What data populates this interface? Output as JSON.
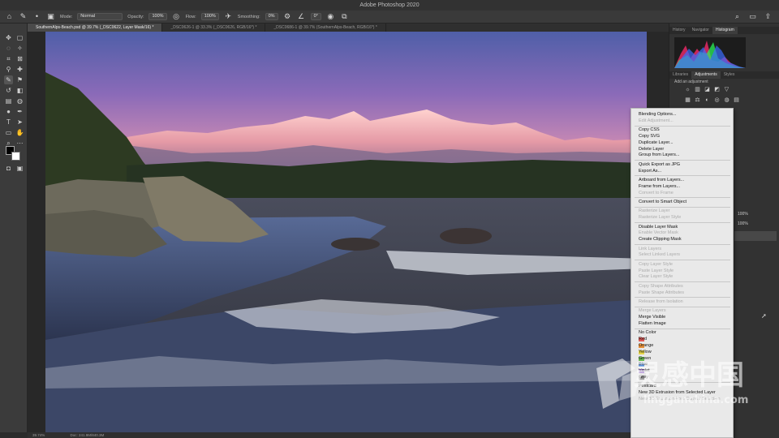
{
  "app": {
    "title": "Adobe Photoshop 2020"
  },
  "options_bar": {
    "mode_label": "Mode:",
    "mode_value": "Normal",
    "opacity_label": "Opacity:",
    "opacity_value": "100%",
    "flow_label": "Flow:",
    "flow_value": "100%",
    "smoothing_label": "Smoothing:",
    "smoothing_value": "0%",
    "angle_value": "0°"
  },
  "document_tabs": [
    {
      "label": "SouthernAlps-Beach.psd @ 39.7% (_DSC0622, Layer Mask/16) *"
    },
    {
      "label": "_DSC0626-1 @ 33.3% (_DSC0626, RGB/16*) *"
    },
    {
      "label": "_DSC0686-1 @ 39.7% (SouthernAlps-Beach, RGB/16*) *"
    }
  ],
  "status_bar": {
    "zoom": "39.74%",
    "doc_size": "Doc: 241.9M/840.3M"
  },
  "panels": {
    "top_tabs": [
      "History",
      "Navigator",
      "Histogram"
    ],
    "mid_tabs": [
      "Libraries",
      "Adjustments",
      "Styles"
    ],
    "add_adjustment_label": "Add an adjustment",
    "layer_opacity_value": "100%",
    "layer_fill_value": "100%"
  },
  "context_menu": {
    "groups": [
      [
        {
          "label": "Blending Options...",
          "enabled": true
        },
        {
          "label": "Edit Adjustment...",
          "enabled": false
        }
      ],
      [
        {
          "label": "Copy CSS",
          "enabled": true
        },
        {
          "label": "Copy SVG",
          "enabled": true
        },
        {
          "label": "Duplicate Layer...",
          "enabled": true
        },
        {
          "label": "Delete Layer",
          "enabled": true
        },
        {
          "label": "Group from Layers...",
          "enabled": true
        }
      ],
      [
        {
          "label": "Quick Export as JPG",
          "enabled": true
        },
        {
          "label": "Export As...",
          "enabled": true
        }
      ],
      [
        {
          "label": "Artboard from Layers...",
          "enabled": true
        },
        {
          "label": "Frame from Layers...",
          "enabled": true
        },
        {
          "label": "Convert to Frame",
          "enabled": false
        }
      ],
      [
        {
          "label": "Convert to Smart Object",
          "enabled": true
        }
      ],
      [
        {
          "label": "Rasterize Layer",
          "enabled": false
        },
        {
          "label": "Rasterize Layer Style",
          "enabled": false
        }
      ],
      [
        {
          "label": "Disable Layer Mask",
          "enabled": true
        },
        {
          "label": "Enable Vector Mask",
          "enabled": false
        },
        {
          "label": "Create Clipping Mask",
          "enabled": true
        }
      ],
      [
        {
          "label": "Link Layers",
          "enabled": false
        },
        {
          "label": "Select Linked Layers",
          "enabled": false
        }
      ],
      [
        {
          "label": "Copy Layer Style",
          "enabled": false
        },
        {
          "label": "Paste Layer Style",
          "enabled": false
        },
        {
          "label": "Clear Layer Style",
          "enabled": false
        }
      ],
      [
        {
          "label": "Copy Shape Attributes",
          "enabled": false
        },
        {
          "label": "Paste Shape Attributes",
          "enabled": false
        }
      ],
      [
        {
          "label": "Release from Isolation",
          "enabled": false
        }
      ],
      [
        {
          "label": "Merge Layers",
          "enabled": false
        },
        {
          "label": "Merge Visible",
          "enabled": true
        },
        {
          "label": "Flatten Image",
          "enabled": true
        }
      ],
      [
        {
          "label": "No Color",
          "enabled": true,
          "color": ""
        },
        {
          "label": "Red",
          "enabled": true,
          "color": "#e05a57"
        },
        {
          "label": "Orange",
          "enabled": true,
          "color": "#e8913a"
        },
        {
          "label": "Yellow",
          "enabled": true,
          "color": "#e6d44a"
        },
        {
          "label": "Green",
          "enabled": true,
          "color": "#6cbb55"
        },
        {
          "label": "Blue",
          "enabled": true,
          "color": "#5a8fd6"
        },
        {
          "label": "Violet",
          "enabled": true,
          "color": "#9a72c9"
        },
        {
          "label": "Gray",
          "enabled": true,
          "color": "#9a9a9a"
        }
      ],
      [
        {
          "label": "Postcard",
          "enabled": true
        },
        {
          "label": "New 3D Extrusion from Selected Layer",
          "enabled": true
        },
        {
          "label": "New 3D Extrusion from Current Selection",
          "enabled": false
        }
      ]
    ]
  },
  "watermark": {
    "text_cn": "灵感中国",
    "text_url": "lingganchina.com"
  },
  "colors": {
    "menu_bg": "#e9e9e9",
    "panel_bg": "#323232",
    "toolbar_bg": "#3b3b3b"
  }
}
